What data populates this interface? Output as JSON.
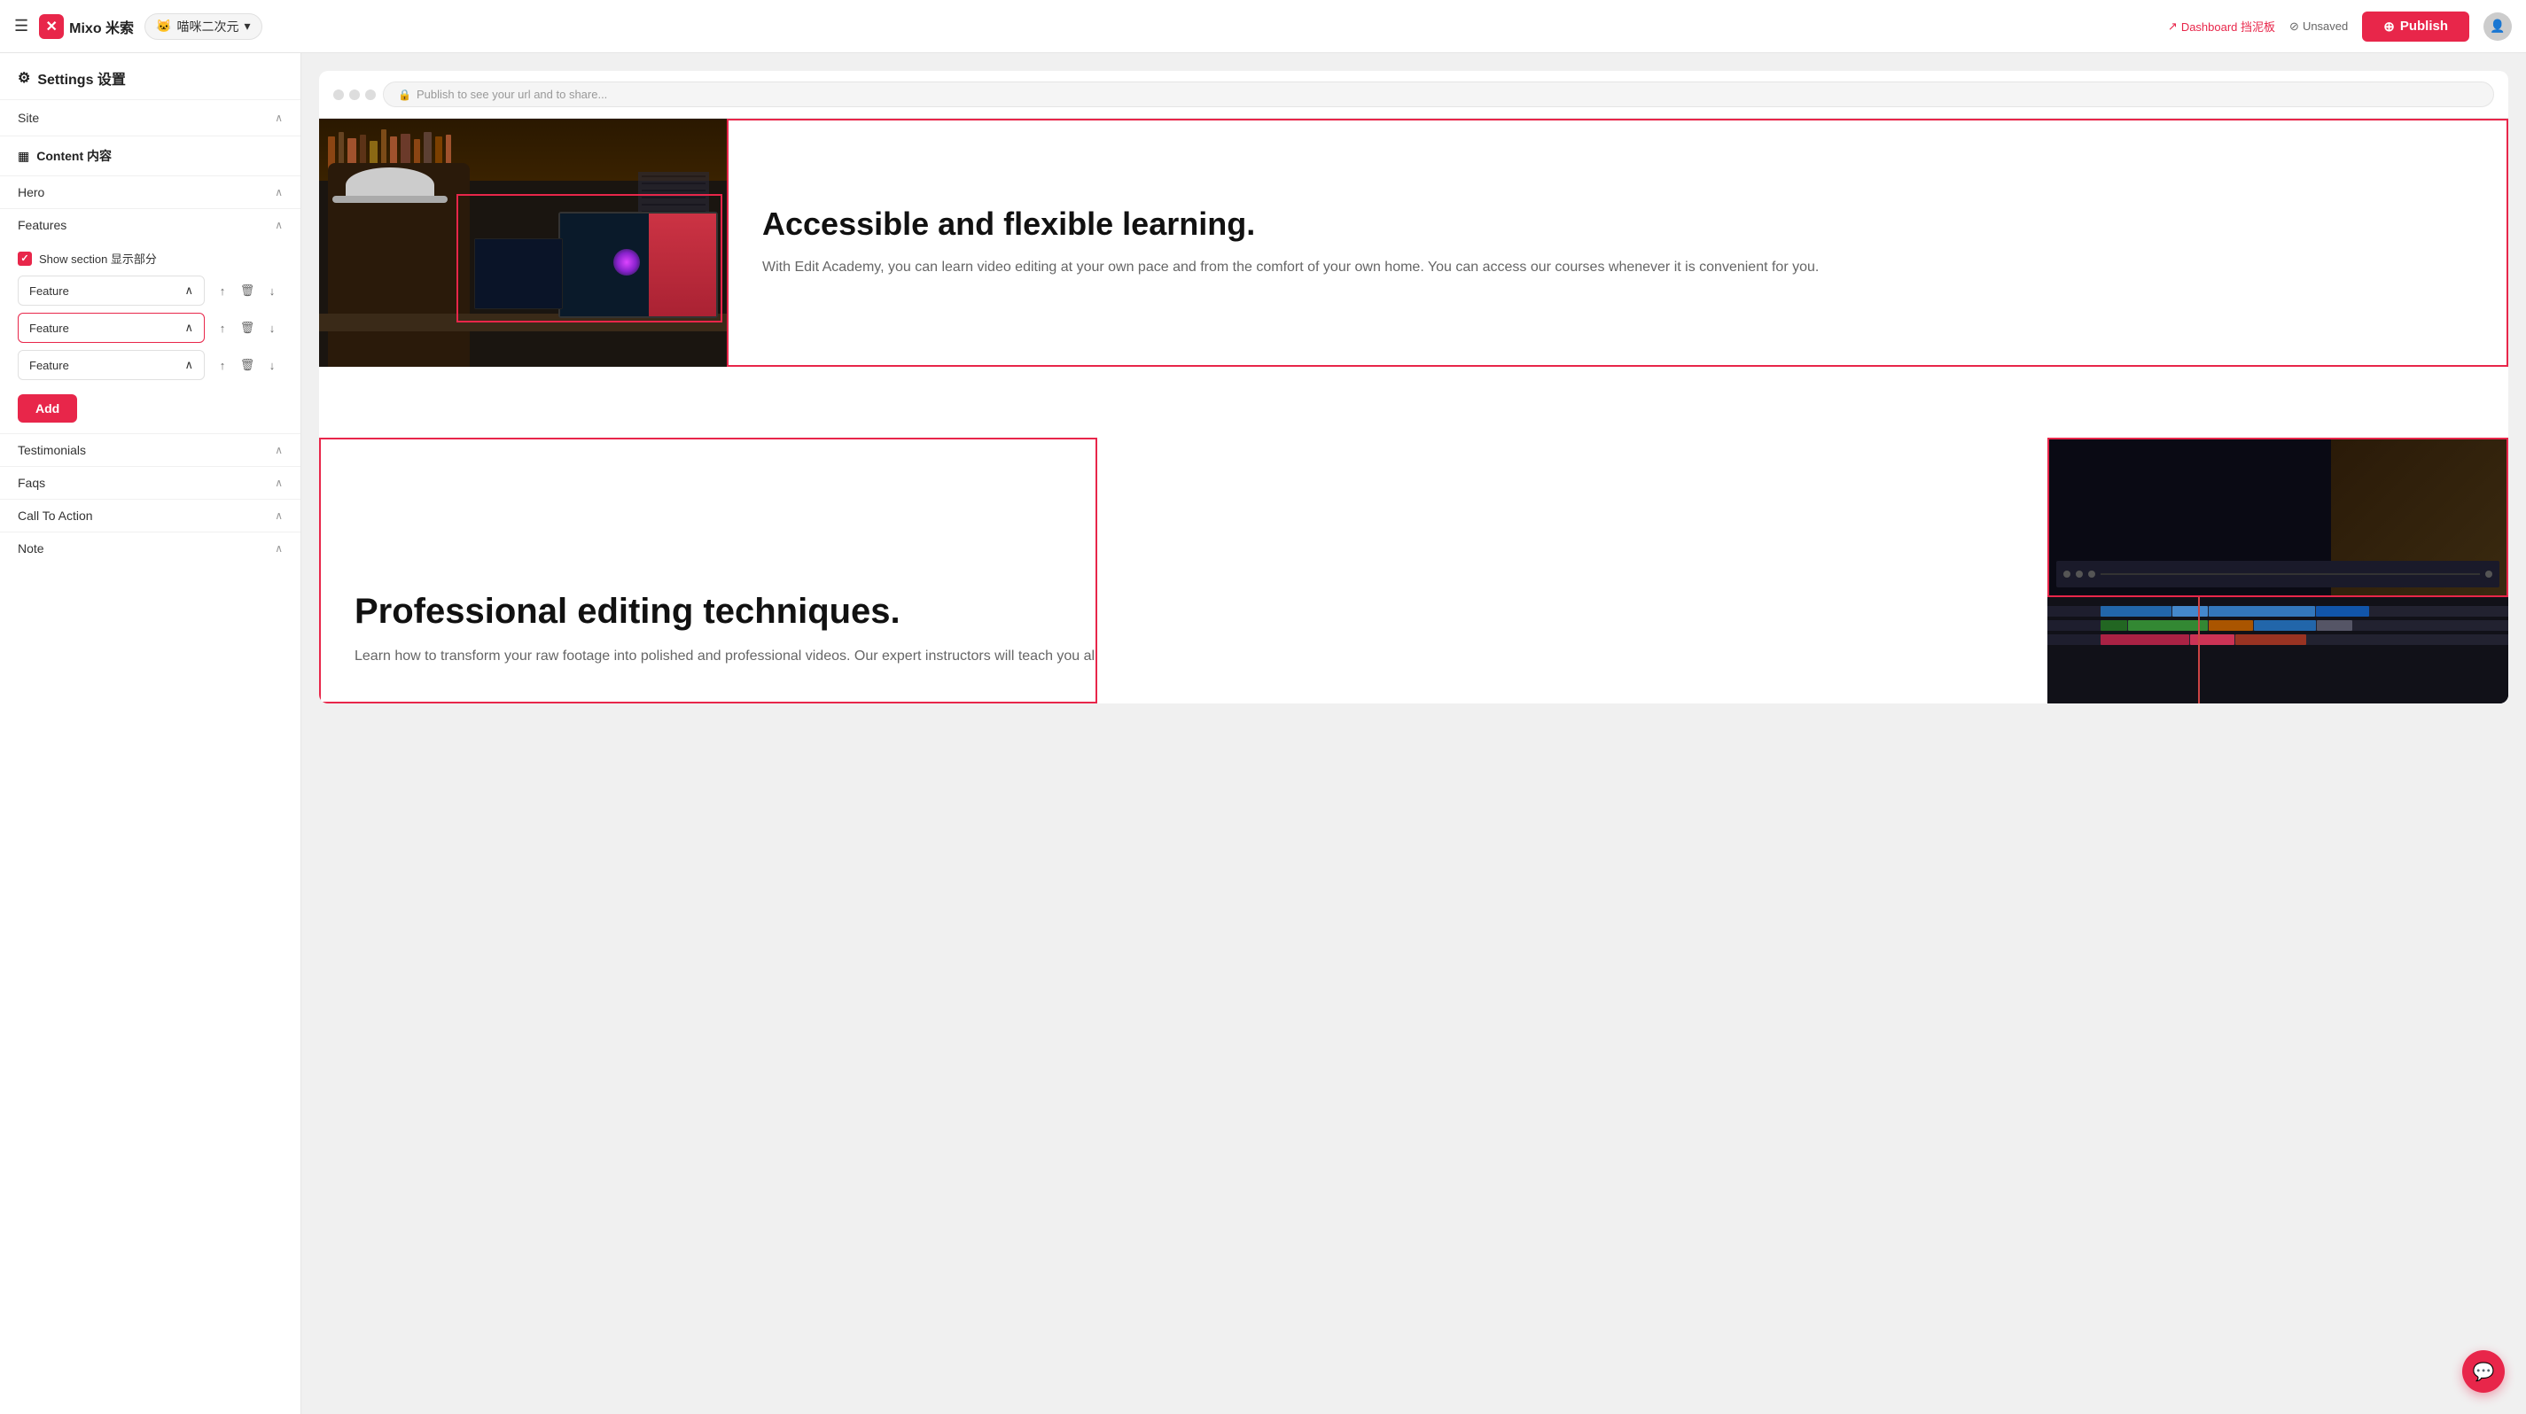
{
  "nav": {
    "hamburger": "☰",
    "logo_x": "✕",
    "logo_text": "Mixo 米索",
    "site_name": "喵咪二次元",
    "site_chevron": "▾",
    "dashboard_icon": "↗",
    "dashboard_label": "Dashboard 挡泥板",
    "unsaved_icon": "⊘",
    "unsaved_label": "Unsaved",
    "publish_icon": "⊕",
    "publish_label": "Publish",
    "avatar_icon": "👤"
  },
  "sidebar": {
    "settings_icon": "⚙",
    "settings_label": "Settings 设置",
    "site_label": "Site",
    "content_icon": "▦",
    "content_label": "Content 内容",
    "hero_label": "Hero",
    "features_label": "Features",
    "show_section_label": "Show section 显示部分",
    "features": [
      {
        "label": "Feature",
        "active": false
      },
      {
        "label": "Feature",
        "active": true
      },
      {
        "label": "Feature",
        "active": false
      }
    ],
    "add_label": "Add",
    "testimonials_label": "Testimonials",
    "faqs_label": "Faqs",
    "call_to_action_label": "Call To Action",
    "note_label": "Note"
  },
  "browser": {
    "url_placeholder": "Publish to see your url and to share...",
    "lock_icon": "🔒"
  },
  "feature1": {
    "title": "Accessible and flexible learning.",
    "description": "With Edit Academy, you can learn video editing at your own pace and from the comfort of your own home. You can access our courses whenever it is convenient for you."
  },
  "feature2": {
    "title": "Professional editing techniques.",
    "description": "Learn how to transform your raw footage into polished and professional videos. Our expert instructors will teach you all"
  },
  "chat": {
    "icon": "💬"
  }
}
